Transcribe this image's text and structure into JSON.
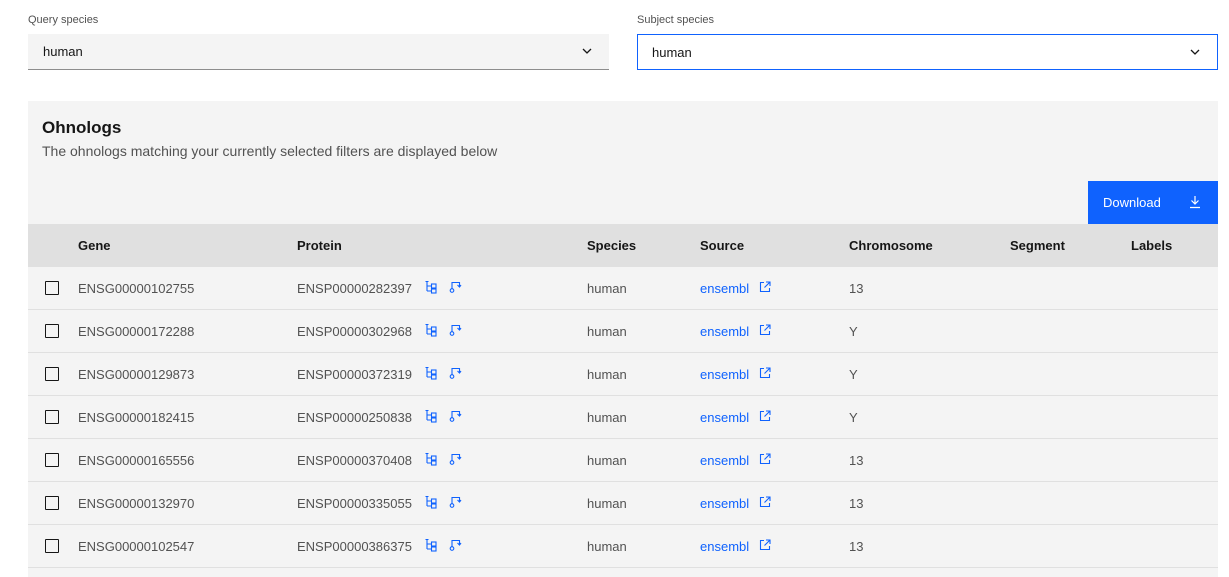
{
  "filters": {
    "query_label": "Query species",
    "query_value": "human",
    "subject_label": "Subject species",
    "subject_value": "human"
  },
  "panel": {
    "title": "Ohnologs",
    "description": "The ohnologs matching your currently selected filters are displayed below",
    "download_label": "Download"
  },
  "table": {
    "headers": {
      "gene": "Gene",
      "protein": "Protein",
      "species": "Species",
      "source": "Source",
      "chromosome": "Chromosome",
      "segment": "Segment",
      "labels": "Labels"
    },
    "rows": [
      {
        "gene": "ENSG00000102755",
        "protein": "ENSP00000282397",
        "species": "human",
        "source": "ensembl",
        "chromosome": "13",
        "segment": "",
        "labels": ""
      },
      {
        "gene": "ENSG00000172288",
        "protein": "ENSP00000302968",
        "species": "human",
        "source": "ensembl",
        "chromosome": "Y",
        "segment": "",
        "labels": ""
      },
      {
        "gene": "ENSG00000129873",
        "protein": "ENSP00000372319",
        "species": "human",
        "source": "ensembl",
        "chromosome": "Y",
        "segment": "",
        "labels": ""
      },
      {
        "gene": "ENSG00000182415",
        "protein": "ENSP00000250838",
        "species": "human",
        "source": "ensembl",
        "chromosome": "Y",
        "segment": "",
        "labels": ""
      },
      {
        "gene": "ENSG00000165556",
        "protein": "ENSP00000370408",
        "species": "human",
        "source": "ensembl",
        "chromosome": "13",
        "segment": "",
        "labels": ""
      },
      {
        "gene": "ENSG00000132970",
        "protein": "ENSP00000335055",
        "species": "human",
        "source": "ensembl",
        "chromosome": "13",
        "segment": "",
        "labels": ""
      },
      {
        "gene": "ENSG00000102547",
        "protein": "ENSP00000386375",
        "species": "human",
        "source": "ensembl",
        "chromosome": "13",
        "segment": "",
        "labels": ""
      }
    ]
  },
  "icons": {
    "dropdown": "chevron-down-icon",
    "download": "download-icon",
    "tree": "tree-view-icon",
    "structure": "structure-view-icon",
    "external": "external-link-icon"
  },
  "colors": {
    "accent": "#0f62fe",
    "panel_bg": "#f4f4f4",
    "header_bg": "#e0e0e0"
  }
}
